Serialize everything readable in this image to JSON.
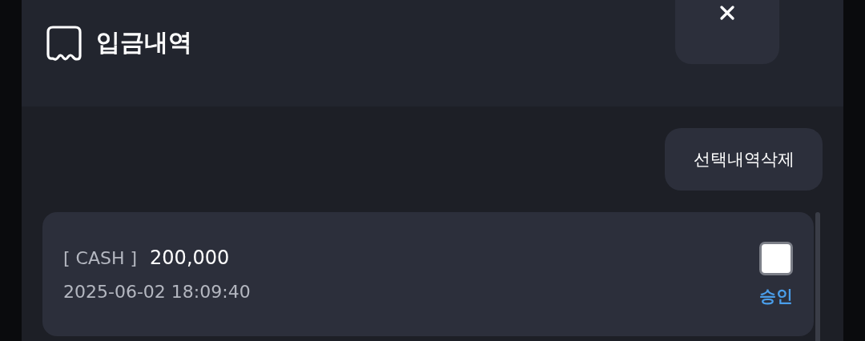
{
  "header": {
    "title": "입금내역"
  },
  "toolbar": {
    "delete_button": "선택내역삭제"
  },
  "entries": [
    {
      "type": "[ CASH ]",
      "amount": "200,000",
      "datetime": "2025-06-02 18:09:40",
      "checked": false,
      "status": "승인"
    }
  ]
}
